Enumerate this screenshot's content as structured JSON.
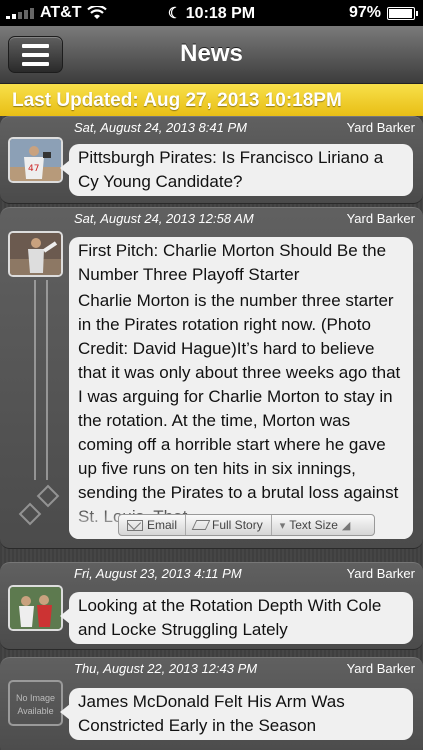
{
  "status_bar": {
    "carrier": "AT&T",
    "time": "10:18 PM",
    "battery_percent": "97%",
    "battery_level": 0.97
  },
  "nav": {
    "title": "News",
    "menu_icon": "hamburger-menu-icon"
  },
  "last_updated": "Last Updated: Aug 27, 2013 10:18PM",
  "news": [
    {
      "date": "Sat, August 24, 2013 8:41 PM",
      "source": "Yard Barker",
      "title": "Pittsburgh Pirates: Is Francisco Liriano a Cy Young Candidate?",
      "thumb": "photo"
    },
    {
      "date": "Sat, August 24, 2013 12:58 AM",
      "source": "Yard Barker",
      "title": "First Pitch: Charlie Morton Should Be the Number Three Playoff Starter",
      "body": "Charlie Morton is the number three starter in the Pirates rotation right now. (Photo Credit: David Hague)It’s hard to believe that it was only about three weeks ago that I was arguing for Charlie Morton to stay in the rotation. At the time, Morton was coming off a horrible start where he gave up five runs on ten hits in six innings, sending the Pirates to a brutal loss against St. Louis. That",
      "thumb": "photo",
      "actions": {
        "email": "Email",
        "full_story": "Full Story",
        "text_size": "Text Size"
      }
    },
    {
      "date": "Fri, August 23, 2013 4:11 PM",
      "source": "Yard Barker",
      "title": "Looking at the Rotation Depth With Cole and Locke Struggling Lately",
      "thumb": "photo"
    },
    {
      "date": "Thu, August 22, 2013 12:43 PM",
      "source": "Yard Barker",
      "title": "James McDonald Felt His Arm Was Constricted Early in the Season",
      "thumb_text": "No Image Available"
    }
  ],
  "colors": {
    "updated_bar": "#f2d02b",
    "bubble": "#f0f0f0",
    "card": "#555555"
  }
}
